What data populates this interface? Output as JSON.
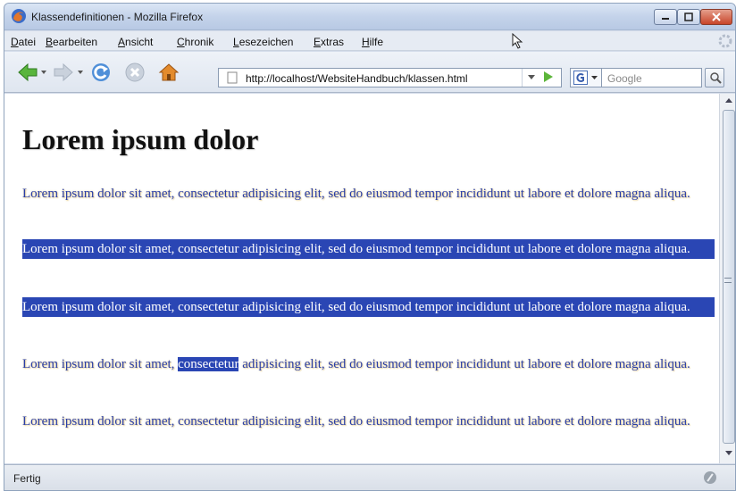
{
  "window": {
    "title": "Klassendefinitionen - Mozilla Firefox"
  },
  "menu": [
    "Datei",
    "Bearbeiten",
    "Ansicht",
    "Chronik",
    "Lesezeichen",
    "Extras",
    "Hilfe"
  ],
  "navigation": {
    "url": "http://localhost/WebsiteHandbuch/klassen.html",
    "search_placeholder": "Google"
  },
  "page": {
    "heading": "Lorem ipsum dolor",
    "p1": "Lorem ipsum dolor sit amet, consectetur adipisicing elit, sed do eiusmod tempor incididunt ut labore et dolore magna aliqua.",
    "p2": "Lorem ipsum dolor sit amet, consectetur adipisicing elit, sed do eiusmod tempor incididunt ut labore et dolore magna aliqua.",
    "p3": "Lorem ipsum dolor sit amet, consectetur adipisicing elit, sed do eiusmod tempor incididunt ut labore et dolore magna aliqua.",
    "p4_before": "Lorem ipsum dolor sit amet, ",
    "p4_highlight": "consectetur",
    "p4_after": " adipisicing elit, sed do eiusmod tempor incididunt ut labore et dolore magna aliqua.",
    "p5": "Lorem ipsum dolor sit amet, consectetur adipisicing elit, sed do eiusmod tempor incididunt ut labore et dolore magna aliqua."
  },
  "status": {
    "text": "Fertig"
  },
  "colors": {
    "link_text": "#2a3ea6",
    "highlight_bg": "#2a46b4"
  }
}
